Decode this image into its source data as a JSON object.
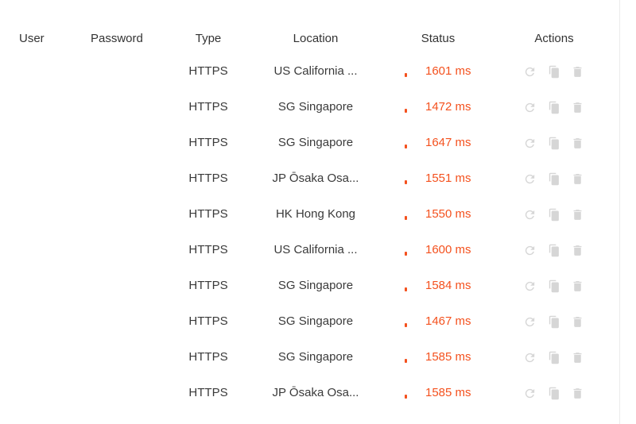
{
  "table": {
    "headers": {
      "user": "User",
      "password": "Password",
      "type": "Type",
      "location": "Location",
      "status": "Status",
      "actions": "Actions"
    },
    "status_color": "#f4511e",
    "icon_color": "#d6d6d6",
    "action_icons": [
      "refresh-icon",
      "copy-icon",
      "trash-icon"
    ],
    "rows": [
      {
        "user": "",
        "password": "",
        "type": "HTTPS",
        "location": "US California ...",
        "status": "1601 ms"
      },
      {
        "user": "",
        "password": "",
        "type": "HTTPS",
        "location": "SG Singapore",
        "status": "1472 ms"
      },
      {
        "user": "",
        "password": "",
        "type": "HTTPS",
        "location": "SG Singapore",
        "status": "1647 ms"
      },
      {
        "user": "",
        "password": "",
        "type": "HTTPS",
        "location": "JP Ōsaka Osa...",
        "status": "1551 ms"
      },
      {
        "user": "",
        "password": "",
        "type": "HTTPS",
        "location": "HK Hong Kong",
        "status": "1550 ms"
      },
      {
        "user": "",
        "password": "",
        "type": "HTTPS",
        "location": "US California ...",
        "status": "1600 ms"
      },
      {
        "user": "",
        "password": "",
        "type": "HTTPS",
        "location": "SG Singapore",
        "status": "1584 ms"
      },
      {
        "user": "",
        "password": "",
        "type": "HTTPS",
        "location": "SG Singapore",
        "status": "1467 ms"
      },
      {
        "user": "",
        "password": "",
        "type": "HTTPS",
        "location": "SG Singapore",
        "status": "1585 ms"
      },
      {
        "user": "",
        "password": "",
        "type": "HTTPS",
        "location": "JP Ōsaka Osa...",
        "status": "1585 ms"
      }
    ]
  }
}
